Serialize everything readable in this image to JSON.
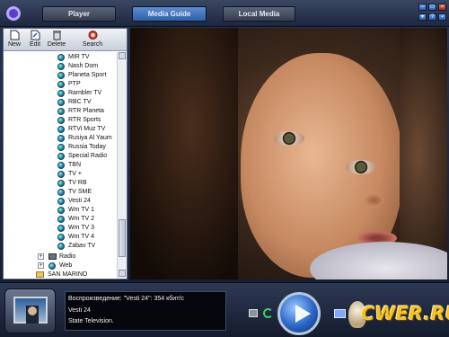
{
  "tabs": {
    "player": "Player",
    "media_guide": "Media Guide",
    "local_media": "Local Media"
  },
  "toolbar": {
    "new": "New",
    "edit": "Edit",
    "delete": "Delete",
    "search": "Search"
  },
  "channels": [
    "MIR TV",
    "Nash Dom",
    "Planeta Sport",
    "PTP",
    "Rambler TV",
    "RBC TV",
    "RTR Planeta",
    "RTR Sports",
    "RTVi Muz TV",
    "Rusiya Al Yaum",
    "Russia Today",
    "Special Radio",
    "TBN",
    "TV +",
    "TV RB",
    "TV SME",
    "Vesti 24",
    "Wm TV 1",
    "Wm TV 2",
    "Wm TV 3",
    "Wm TV 4",
    "Zabav TV"
  ],
  "folders": {
    "radio": "Radio",
    "web": "Web",
    "country": "SAN MARINO"
  },
  "now_playing": {
    "line1": "Воспроизведение: \"Vesti 24\": 354 кбит/с",
    "line2": "Vesti 24",
    "line3": "State Television."
  },
  "logo": {
    "text": "CWER.RU"
  },
  "colors": {
    "active_tab": "#3f74bf",
    "accent": "#2a66c7",
    "logo": "#f2c22a"
  },
  "icons": [
    "app-logo-icon",
    "new-icon",
    "edit-icon",
    "delete-icon",
    "search-icon",
    "globe-icon",
    "folder-icon",
    "stop-icon",
    "repeat-icon",
    "play-icon",
    "monitor-icon"
  ]
}
